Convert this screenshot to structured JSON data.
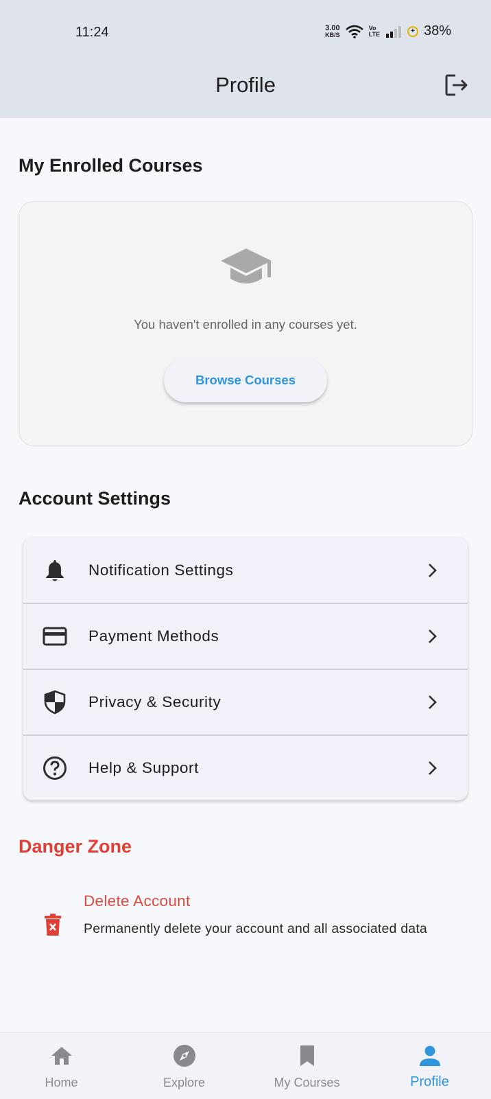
{
  "status_bar": {
    "time": "11:24",
    "net_speed_value": "3.00",
    "net_speed_unit": "KB/S",
    "volte_top": "Vo",
    "volte_bottom": "LTE",
    "battery": "38%"
  },
  "app_bar": {
    "title": "Profile",
    "logout_icon": "logout-icon"
  },
  "enrolled": {
    "section_title": "My Enrolled Courses",
    "empty_icon": "graduation-cap-icon",
    "empty_message": "You haven't enrolled in any courses yet.",
    "browse_button": "Browse Courses"
  },
  "account_settings": {
    "section_title": "Account Settings",
    "items": [
      {
        "label": "Notification Settings",
        "icon": "bell-icon"
      },
      {
        "label": "Payment Methods",
        "icon": "credit-card-icon"
      },
      {
        "label": "Privacy & Security",
        "icon": "shield-icon"
      },
      {
        "label": "Help & Support",
        "icon": "help-circle-icon"
      }
    ]
  },
  "danger_zone": {
    "section_title": "Danger Zone",
    "delete_title": "Delete Account",
    "delete_description": "Permanently delete your account and all associated data",
    "delete_icon": "trash-icon"
  },
  "bottom_nav": {
    "items": [
      {
        "label": "Home",
        "icon": "home-icon"
      },
      {
        "label": "Explore",
        "icon": "compass-icon"
      },
      {
        "label": "My Courses",
        "icon": "bookmark-icon"
      },
      {
        "label": "Profile",
        "icon": "person-icon"
      }
    ],
    "active": "Profile"
  },
  "colors": {
    "accent": "#2f95dc",
    "danger": "#e04035",
    "app_bar_bg": "#dfe3ec",
    "page_bg": "#f7f8fc"
  }
}
